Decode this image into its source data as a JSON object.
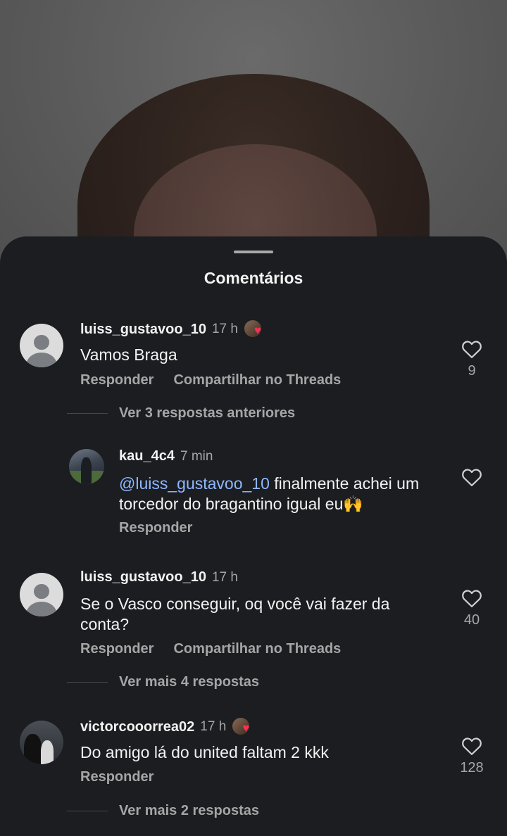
{
  "sheet": {
    "title": "Comentários"
  },
  "comments": [
    {
      "username": "luiss_gustavoo_10",
      "time": "17 h",
      "text": "Vamos Braga",
      "likes": "9",
      "reply_label": "Responder",
      "share_label": "Compartilhar no Threads",
      "replies_label": "Ver 3 respostas anteriores",
      "avatar_icon": "default-avatar-icon"
    },
    {
      "username": "kau_4c4",
      "time": "7 min",
      "mention": "@luiss_gustavoo_10",
      "text": " finalmente achei um torcedor do bragantino igual eu🙌",
      "reply_label": "Responder"
    },
    {
      "username": "luiss_gustavoo_10",
      "time": "17 h",
      "text": "Se o Vasco conseguir, oq você vai fazer da conta?",
      "likes": "40",
      "reply_label": "Responder",
      "share_label": "Compartilhar no Threads",
      "replies_label": "Ver mais 4 respostas"
    },
    {
      "username": "victorcooorrea02",
      "time": "17 h",
      "text": "Do amigo lá do united faltam 2 kkk",
      "likes": "128",
      "reply_label": "Responder",
      "replies_label": "Ver mais 2 respostas"
    }
  ],
  "colors": {
    "sheet_bg": "#1b1d21",
    "mention": "#8fb7ff",
    "like_heart": "#ff2d55"
  }
}
